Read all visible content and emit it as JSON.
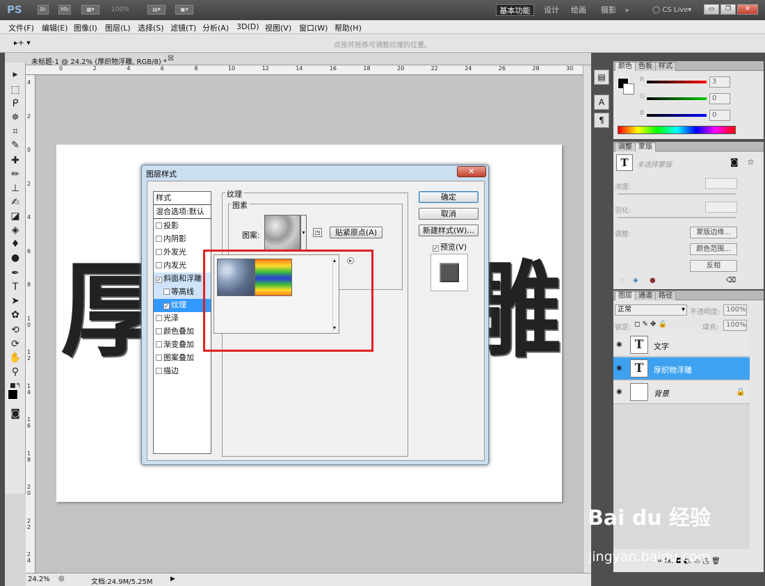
{
  "app": {
    "logo": "PS",
    "zoom_combo": "100%",
    "workspaces": [
      "基本功能",
      "设计",
      "绘画",
      "摄影",
      "»"
    ],
    "cslive": "CS Live▾",
    "win_buttons": [
      "▭",
      "❐",
      "✕"
    ]
  },
  "menu": [
    "文件(F)",
    "编辑(E)",
    "图像(I)",
    "图层(L)",
    "选择(S)",
    "滤镜(T)",
    "分析(A)",
    "3D(D)",
    "视图(V)",
    "窗口(W)",
    "帮助(H)"
  ],
  "options_bar": {
    "tool_icon": "▸+ ▾",
    "hint": "点按并拖移可调整纹理的位置。"
  },
  "document": {
    "tab_title": "未标题-1 @ 24.2% (厚织物浮雕, RGB/8) *",
    "close_glyph": "☒",
    "ruler_top": [
      "0",
      "2",
      "4",
      "6",
      "8",
      "10",
      "12",
      "14",
      "16",
      "18",
      "20",
      "22",
      "24",
      "26",
      "28",
      "30"
    ],
    "ruler_left": [
      "4",
      "2",
      "0",
      "2",
      "4",
      "6",
      "8",
      "1 0",
      "1 2",
      "1 4",
      "1 6",
      "1 8",
      "2 0",
      "2 2",
      "2 4"
    ],
    "canvas_text_left": "厚",
    "canvas_text_right": "雕"
  },
  "status": {
    "zoom": "24.2%",
    "doc": "文档:24.9M/5.25M",
    "play": "▶"
  },
  "dialog": {
    "title": "图层样式",
    "close": "✕",
    "styles_header": "样式",
    "blend_header": "混合选项:默认",
    "items": [
      {
        "label": "投影",
        "checked": false
      },
      {
        "label": "内阴影",
        "checked": false
      },
      {
        "label": "外发光",
        "checked": false
      },
      {
        "label": "内发光",
        "checked": false
      },
      {
        "label": "斜面和浮雕",
        "checked": true
      },
      {
        "label": "等高线",
        "checked": false
      },
      {
        "label": "纹理",
        "checked": true
      },
      {
        "label": "光泽",
        "checked": false
      },
      {
        "label": "颜色叠加",
        "checked": false
      },
      {
        "label": "渐变叠加",
        "checked": false
      },
      {
        "label": "图案叠加",
        "checked": false
      },
      {
        "label": "描边",
        "checked": false
      }
    ],
    "texture_legend": "纹理",
    "pattern_legend": "图素",
    "pattern_label": "图案:",
    "snap_button": "贴紧原点(A)",
    "ok": "确定",
    "cancel": "取消",
    "new_style": "新建样式(W)...",
    "preview": "预览(V)",
    "popup_scroll_up": "▴",
    "popup_scroll_down": "▾",
    "popup_menu": "▸",
    "colors": {
      "selection": "#3399ff",
      "highlight_box": "#e02020"
    }
  },
  "color_panel": {
    "tabs": [
      "颜色",
      "色板",
      "样式"
    ],
    "channels": [
      {
        "name": "R",
        "value": "3"
      },
      {
        "name": "G",
        "value": "0"
      },
      {
        "name": "B",
        "value": "0"
      }
    ]
  },
  "adjust_panel": {
    "tabs": [
      "调整",
      "蒙版"
    ],
    "title": "未选择蒙版",
    "density": "浓度:",
    "feather": "羽化:",
    "refine": "调整:",
    "buttons": [
      "蒙版边缘...",
      "颜色范围...",
      "反相"
    ]
  },
  "layers_panel": {
    "tabs": [
      "图层",
      "通道",
      "路径"
    ],
    "blend_mode": "正常",
    "opacity_label": "不透明度:",
    "opacity": "100%",
    "lock_label": "锁定:",
    "fill_label": "填充:",
    "fill": "100%",
    "layers": [
      {
        "name": "文字",
        "thumb": "T",
        "selected": false
      },
      {
        "name": "厚织物浮雕",
        "thumb": "T",
        "selected": true
      },
      {
        "name": "背景",
        "thumb": "",
        "selected": false
      }
    ],
    "bottom_icons": "⚭ fx. ◘ ◐. ▭ ◳ 🗑"
  },
  "watermark": {
    "line1": "Bai du 经验",
    "line2": "jingyan.baidu.com"
  }
}
